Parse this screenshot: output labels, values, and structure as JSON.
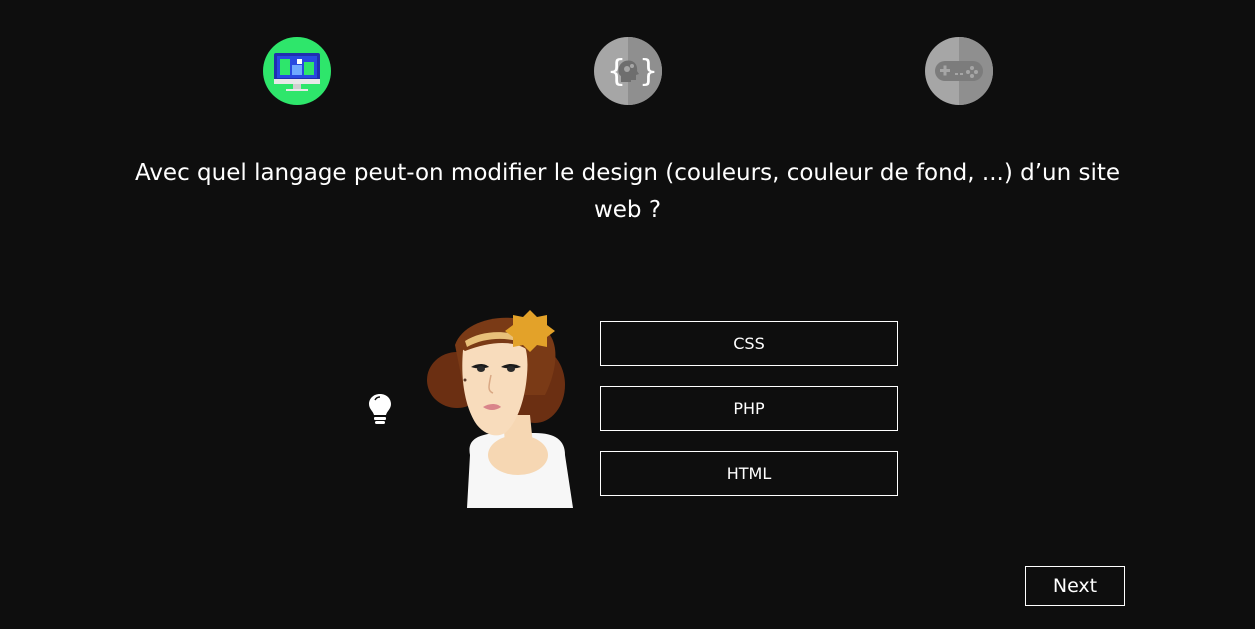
{
  "steps": [
    {
      "icon": "monitor-icon",
      "state": "active",
      "color": "#2ee66b"
    },
    {
      "icon": "code-brain-icon",
      "state": "inactive",
      "color": "#a6a6a6"
    },
    {
      "icon": "gamepad-icon",
      "state": "inactive",
      "color": "#a6a6a6"
    }
  ],
  "question": {
    "text": "Avec quel langage peut-on modifier le design (couleurs, couleur de fond, ...) d’un site web ?"
  },
  "hint": {
    "icon": "lightbulb-icon"
  },
  "avatar": {
    "icon": "character-avatar"
  },
  "answers": [
    {
      "label": "CSS"
    },
    {
      "label": "PHP"
    },
    {
      "label": "HTML"
    }
  ],
  "next": {
    "label": "Next"
  },
  "colors": {
    "background": "#0e0e0e",
    "accent": "#2ee66b",
    "inactive": "#a6a6a6",
    "text": "#ffffff"
  }
}
